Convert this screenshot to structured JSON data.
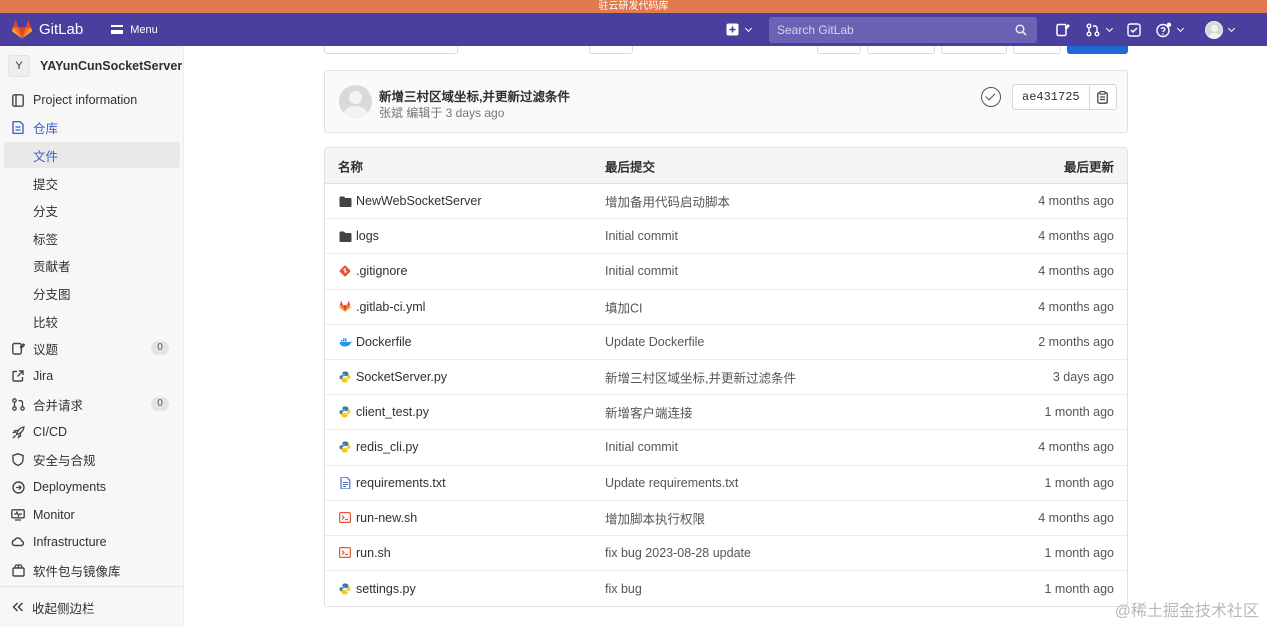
{
  "env_banner": "驻云研发代码库",
  "navbar": {
    "brand": "GitLab",
    "menu_label": "Menu",
    "search_placeholder": "Search GitLab"
  },
  "sidebar": {
    "project_initial": "Y",
    "project_name": "YAYunCunSocketServer",
    "items": [
      {
        "label": "Project information",
        "icon": "info-icon"
      },
      {
        "label": "仓库",
        "icon": "repository-icon"
      },
      {
        "label": "文件"
      },
      {
        "label": "提交"
      },
      {
        "label": "分支"
      },
      {
        "label": "标签"
      },
      {
        "label": "贡献者"
      },
      {
        "label": "分支图"
      },
      {
        "label": "比较"
      },
      {
        "label": "议题",
        "icon": "issues-icon",
        "count": "0"
      },
      {
        "label": "Jira",
        "icon": "external-link-icon"
      },
      {
        "label": "合并请求",
        "icon": "merge-request-icon",
        "count": "0"
      },
      {
        "label": "CI/CD",
        "icon": "rocket-icon"
      },
      {
        "label": "安全与合规",
        "icon": "shield-icon"
      },
      {
        "label": "Deployments",
        "icon": "deployments-icon"
      },
      {
        "label": "Monitor",
        "icon": "monitor-icon"
      },
      {
        "label": "Infrastructure",
        "icon": "cloud-icon"
      },
      {
        "label": "软件包与镜像库",
        "icon": "package-icon"
      }
    ],
    "collapse_label": "收起侧边栏"
  },
  "last_commit": {
    "title": "新增三村区域坐标,并更新过滤条件",
    "meta": "张斌 编辑于 3 days ago",
    "sha": "ae431725"
  },
  "file_table": {
    "headers": {
      "name": "名称",
      "last_commit": "最后提交",
      "last_update": "最后更新"
    },
    "rows": [
      {
        "name": "NewWebSocketServer",
        "type": "folder",
        "commit": "增加备用代码启动脚本",
        "date": "4 months ago"
      },
      {
        "name": "logs",
        "type": "folder",
        "commit": "Initial commit",
        "date": "4 months ago"
      },
      {
        "name": ".gitignore",
        "type": "git",
        "commit": "Initial commit",
        "date": "4 months ago"
      },
      {
        "name": ".gitlab-ci.yml",
        "type": "gitlab",
        "commit": "填加CI",
        "date": "4 months ago"
      },
      {
        "name": "Dockerfile",
        "type": "docker",
        "commit": "Update Dockerfile",
        "date": "2 months ago"
      },
      {
        "name": "SocketServer.py",
        "type": "python",
        "commit": "新增三村区域坐标,并更新过滤条件",
        "date": "3 days ago"
      },
      {
        "name": "client_test.py",
        "type": "python",
        "commit": "新增客户端连接",
        "date": "1 month ago"
      },
      {
        "name": "redis_cli.py",
        "type": "python",
        "commit": "Initial commit",
        "date": "4 months ago"
      },
      {
        "name": "requirements.txt",
        "type": "text",
        "commit": "Update requirements.txt",
        "date": "1 month ago"
      },
      {
        "name": "run-new.sh",
        "type": "shell",
        "commit": "增加脚本执行权限",
        "date": "4 months ago"
      },
      {
        "name": "run.sh",
        "type": "shell",
        "commit": "fix bug 2023-08-28 update",
        "date": "1 month ago"
      },
      {
        "name": "settings.py",
        "type": "python",
        "commit": "fix bug",
        "date": "1 month ago"
      }
    ]
  },
  "watermark": "@稀土掘金技术社区",
  "colors": {
    "navbar": "#4a3f9e",
    "banner": "#e07a4f",
    "active_link": "#3a60c8",
    "primary_button": "#1f6ad6"
  }
}
